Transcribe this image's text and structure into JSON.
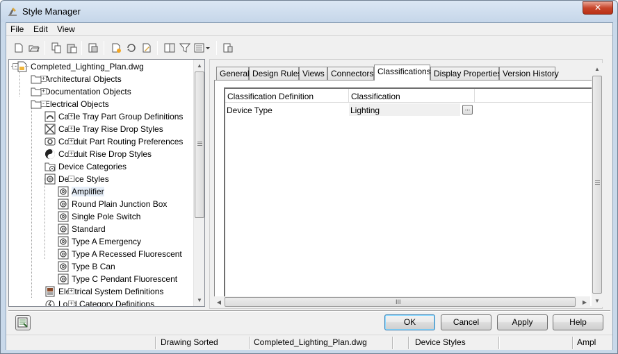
{
  "window": {
    "title": "Style Manager",
    "close_label": "✕"
  },
  "menu": [
    {
      "label": "File"
    },
    {
      "label": "Edit"
    },
    {
      "label": "View"
    }
  ],
  "toolbar": [
    {
      "icon": "new-document-icon"
    },
    {
      "icon": "open-folder-icon"
    },
    {
      "icon": "copy-icon"
    },
    {
      "icon": "paste-icon"
    },
    {
      "icon": "purge-icon"
    },
    {
      "icon": "new-style-icon"
    },
    {
      "icon": "set-from-icon"
    },
    {
      "icon": "edit-style-icon"
    },
    {
      "icon": "toggle-view-icon"
    },
    {
      "icon": "filter-icon"
    },
    {
      "icon": "view-mode-icon"
    },
    {
      "icon": "inline-edit-icon"
    }
  ],
  "tree": [
    {
      "label": "Completed_Lighting_Plan.dwg",
      "icon": "drawing-file-icon",
      "expander": "-"
    },
    {
      "label": "Architectural Objects",
      "icon": "folder-icon",
      "expander": "+"
    },
    {
      "label": "Documentation Objects",
      "icon": "folder-icon",
      "expander": "+"
    },
    {
      "label": "Electrical Objects",
      "icon": "folder-icon",
      "expander": "-"
    },
    {
      "label": "Cable Tray Part Group Definitions",
      "icon": "cable-tray-group-icon",
      "expander": "+"
    },
    {
      "label": "Cable Tray Rise Drop Styles",
      "icon": "rise-drop-icon",
      "expander": "+"
    },
    {
      "label": "Conduit Part Routing Preferences",
      "icon": "conduit-routing-icon",
      "expander": "+"
    },
    {
      "label": "Conduit Rise Drop Styles",
      "icon": "conduit-rise-drop-icon",
      "expander": "+"
    },
    {
      "label": "Device Categories",
      "icon": "device-categories-icon",
      "expander": ""
    },
    {
      "label": "Device Styles",
      "icon": "device-style-icon",
      "expander": "-"
    },
    {
      "label": "Amplifier",
      "icon": "device-style-icon",
      "expander": ""
    },
    {
      "label": "Round Plain Junction Box",
      "icon": "device-style-icon",
      "expander": ""
    },
    {
      "label": "Single Pole Switch",
      "icon": "device-style-icon",
      "expander": ""
    },
    {
      "label": "Standard",
      "icon": "device-style-icon",
      "expander": ""
    },
    {
      "label": "Type A Emergency",
      "icon": "device-style-icon",
      "expander": ""
    },
    {
      "label": "Type A Recessed Fluorescent",
      "icon": "device-style-icon",
      "expander": ""
    },
    {
      "label": "Type B Can",
      "icon": "device-style-icon",
      "expander": ""
    },
    {
      "label": "Type C Pendant Fluorescent",
      "icon": "device-style-icon",
      "expander": ""
    },
    {
      "label": "Electrical System Definitions",
      "icon": "system-definitions-icon",
      "expander": "+"
    },
    {
      "label": "Load Category Definitions",
      "icon": "load-category-icon",
      "expander": "+"
    }
  ],
  "tabs": [
    {
      "label": "General"
    },
    {
      "label": "Design Rules"
    },
    {
      "label": "Views"
    },
    {
      "label": "Connectors"
    },
    {
      "label": "Classifications"
    },
    {
      "label": "Display Properties"
    },
    {
      "label": "Version History"
    }
  ],
  "active_tab": "Classifications",
  "grid": {
    "columns": [
      "Classification Definition",
      "Classification"
    ],
    "rows": [
      {
        "definition": "Device Type",
        "classification": "Lighting",
        "button": "..."
      }
    ]
  },
  "hscroll_grip": "III",
  "buttons": {
    "ok": "OK",
    "cancel": "Cancel",
    "apply": "Apply",
    "help": "Help"
  },
  "status": [
    "",
    "Drawing Sorted",
    "Completed_Lighting_Plan.dwg",
    "",
    "Device Styles",
    "",
    "Ampl"
  ],
  "colors": {
    "selection": "#e6eef8",
    "titlebar": "#c5d6e9",
    "close": "#c7452a"
  }
}
